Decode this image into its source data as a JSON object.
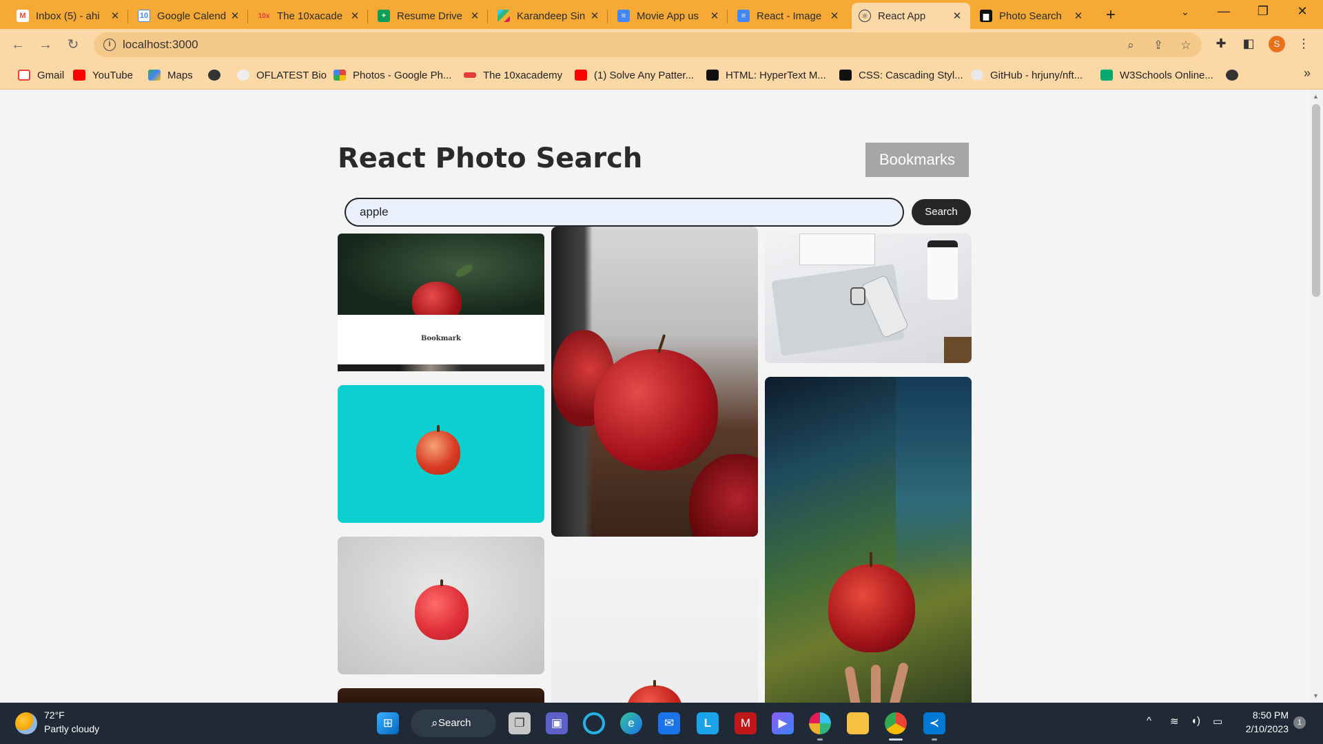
{
  "browser": {
    "tabs": [
      {
        "title": "Inbox (5) - ahi",
        "favicon": "gmail-icon",
        "color": "#ea4335"
      },
      {
        "title": "Google Calend",
        "favicon": "google-calendar-icon",
        "color": "#4285f4"
      },
      {
        "title": "The 10xacade",
        "favicon": "10x-academy-icon",
        "color": "#e23b3b"
      },
      {
        "title": "Resume Drive",
        "favicon": "google-sheets-icon",
        "color": "#0f9d58"
      },
      {
        "title": "Karandeep Sin",
        "favicon": "slack-icon",
        "color": "#e01e5a"
      },
      {
        "title": "Movie App us",
        "favicon": "google-docs-icon",
        "color": "#4285f4"
      },
      {
        "title": "React - Image",
        "favicon": "google-docs-icon",
        "color": "#4285f4"
      },
      {
        "title": "React App",
        "favicon": "react-icon",
        "color": "#2a3c4e"
      },
      {
        "title": "Photo Search",
        "favicon": "unsplash-icon",
        "color": "#111111"
      }
    ],
    "new_tab": "+",
    "url": "localhost:3000",
    "profile_initial": "S",
    "bookmarks": [
      {
        "label": "Gmail",
        "icon": "gmail-icon",
        "color": "#ea4335"
      },
      {
        "label": "YouTube",
        "icon": "youtube-icon",
        "color": "#ff0000"
      },
      {
        "label": "Maps",
        "icon": "maps-icon",
        "color": "#34a853"
      },
      {
        "label": "",
        "icon": "globe-icon",
        "color": "#333333"
      },
      {
        "label": "OFLATEST Bio",
        "icon": "oflatest-icon",
        "color": "#e6e6e6"
      },
      {
        "label": "Photos - Google Ph...",
        "icon": "google-photos-icon",
        "color": "#fbbc05"
      },
      {
        "label": "The 10xacademy",
        "icon": "10x-academy-icon",
        "color": "#e23b3b"
      },
      {
        "label": "(1) Solve Any Patter...",
        "icon": "youtube-icon",
        "color": "#ff0000"
      },
      {
        "label": "HTML: HyperText M...",
        "icon": "mdn-icon",
        "color": "#111111"
      },
      {
        "label": "CSS: Cascading Styl...",
        "icon": "mdn-icon",
        "color": "#111111"
      },
      {
        "label": "GitHub - hrjuny/nft...",
        "icon": "github-icon",
        "color": "#e8e8e8"
      },
      {
        "label": "W3Schools Online...",
        "icon": "w3schools-icon",
        "color": "#04aa6d"
      },
      {
        "label": "",
        "icon": "globe-icon",
        "color": "#333333"
      }
    ]
  },
  "app": {
    "title": "React Photo Search",
    "bookmarks_button": "Bookmarks",
    "search_value": "apple",
    "search_button": "Search",
    "bookmark_label": "Bookmark"
  },
  "taskbar": {
    "weather_temp": "72°F",
    "weather_desc": "Partly cloudy",
    "search_label": "Search",
    "time": "8:50 PM",
    "date": "2/10/2023",
    "notification_count": "1"
  }
}
